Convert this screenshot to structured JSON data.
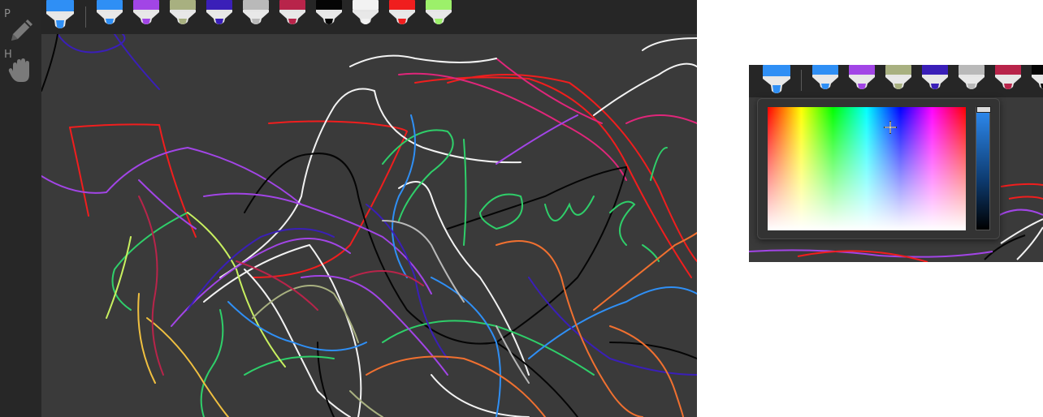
{
  "sidebar": {
    "tools": [
      {
        "key": "P",
        "icon": "pencil-icon"
      },
      {
        "key": "H",
        "icon": "hand-icon"
      }
    ]
  },
  "toolbar": {
    "selected_color": "#2f8ff5",
    "markers": [
      "#2f8ff5",
      "#a245e6",
      "#a8b080",
      "#3a1fb8",
      "#b9b9b9",
      "#b8244a",
      "#050505",
      "#f2f2f2",
      "#f01e1e",
      "#9cf06a"
    ]
  },
  "picker": {
    "toolbar_markers": [
      "#2f8ff5",
      "#2f8ff5",
      "#a245e6",
      "#a8b080",
      "#3a1fb8",
      "#b9b9b9",
      "#b8244a",
      "#050505"
    ],
    "hue_gradient": [
      "#ff0000",
      "#ffff00",
      "#00ff00",
      "#00ffff",
      "#0000ff",
      "#ff00ff",
      "#ff0000"
    ],
    "brightness_top_color": "#2e8cf3"
  }
}
